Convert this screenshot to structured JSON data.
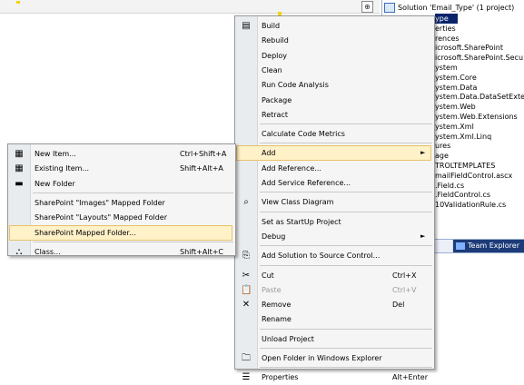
{
  "editor": {
    "split_glyph": "⊕"
  },
  "solution_explorer": {
    "title": "Solution 'Email_Type' (1 project)",
    "rows": [
      {
        "text": "ype",
        "selected": true
      },
      {
        "text": "erties"
      },
      {
        "text": "rences"
      },
      {
        "text": "icrosoft.SharePoint"
      },
      {
        "text": "icrosoft.SharePoint.Secu"
      },
      {
        "text": "ystem"
      },
      {
        "text": "ystem.Core"
      },
      {
        "text": "ystem.Data"
      },
      {
        "text": "ystem.Data.DataSetExte"
      },
      {
        "text": "ystem.Web"
      },
      {
        "text": "ystem.Web.Extensions"
      },
      {
        "text": "ystem.Xml"
      },
      {
        "text": "ystem.Xml.Linq"
      },
      {
        "text": "ures"
      },
      {
        "text": "age"
      },
      {
        "text": "TROLTEMPLATES"
      },
      {
        "text": "mailFieldControl.ascx"
      },
      {
        "text": ".Field.cs"
      },
      {
        "text": ".FieldControl.cs"
      },
      {
        "text": "10ValidationRule.cs"
      }
    ],
    "tab_left": "rer",
    "tab_right": "Team Explorer"
  },
  "main_menu": {
    "items": [
      {
        "label": "Build",
        "icon": "build-icon",
        "glyph": "▤"
      },
      {
        "label": "Rebuild"
      },
      {
        "label": "Deploy"
      },
      {
        "label": "Clean"
      },
      {
        "label": "Run Code Analysis"
      },
      {
        "label": "Package"
      },
      {
        "label": "Retract"
      },
      {
        "sep": true
      },
      {
        "label": "Calculate Code Metrics"
      },
      {
        "sep": true
      },
      {
        "label": "Add",
        "submenu": true,
        "highlight": true
      },
      {
        "label": "Add Reference..."
      },
      {
        "label": "Add Service Reference..."
      },
      {
        "sep": true
      },
      {
        "label": "View Class Diagram",
        "icon": "class-diagram-icon",
        "glyph": "⌕"
      },
      {
        "sep": true
      },
      {
        "label": "Set as StartUp Project"
      },
      {
        "label": "Debug",
        "submenu": true
      },
      {
        "sep": true
      },
      {
        "label": "Add Solution to Source Control...",
        "icon": "source-control-icon",
        "glyph": "⎘"
      },
      {
        "sep": true
      },
      {
        "label": "Cut",
        "shortcut": "Ctrl+X",
        "icon": "cut-icon",
        "glyph": "✂"
      },
      {
        "label": "Paste",
        "shortcut": "Ctrl+V",
        "disabled": true,
        "icon": "paste-icon",
        "glyph": "📋"
      },
      {
        "label": "Remove",
        "shortcut": "Del",
        "icon": "remove-icon",
        "glyph": "✕"
      },
      {
        "label": "Rename"
      },
      {
        "sep": true
      },
      {
        "label": "Unload Project"
      },
      {
        "sep": true
      },
      {
        "label": "Open Folder in Windows Explorer",
        "icon": "folder-open-icon",
        "glyph": "🗀"
      },
      {
        "sep": true
      },
      {
        "label": "Properties",
        "shortcut": "Alt+Enter",
        "icon": "properties-icon",
        "glyph": "☰"
      }
    ],
    "submenu_arrow": "►"
  },
  "add_submenu": {
    "items": [
      {
        "label": "New Item...",
        "shortcut": "Ctrl+Shift+A",
        "icon": "new-item-icon",
        "glyph": "▦"
      },
      {
        "label": "Existing Item...",
        "shortcut": "Shift+Alt+A",
        "icon": "existing-item-icon",
        "glyph": "▦"
      },
      {
        "label": "New Folder",
        "icon": "folder-icon",
        "glyph": "▬"
      },
      {
        "sep": true
      },
      {
        "label": "SharePoint \"Images\" Mapped Folder"
      },
      {
        "label": "SharePoint \"Layouts\" Mapped Folder"
      },
      {
        "label": "SharePoint Mapped Folder...",
        "highlight": true
      },
      {
        "sep": true
      },
      {
        "label": "Class...",
        "shortcut": "Shift+Alt+C",
        "icon": "class-icon",
        "glyph": "⛬"
      }
    ]
  }
}
